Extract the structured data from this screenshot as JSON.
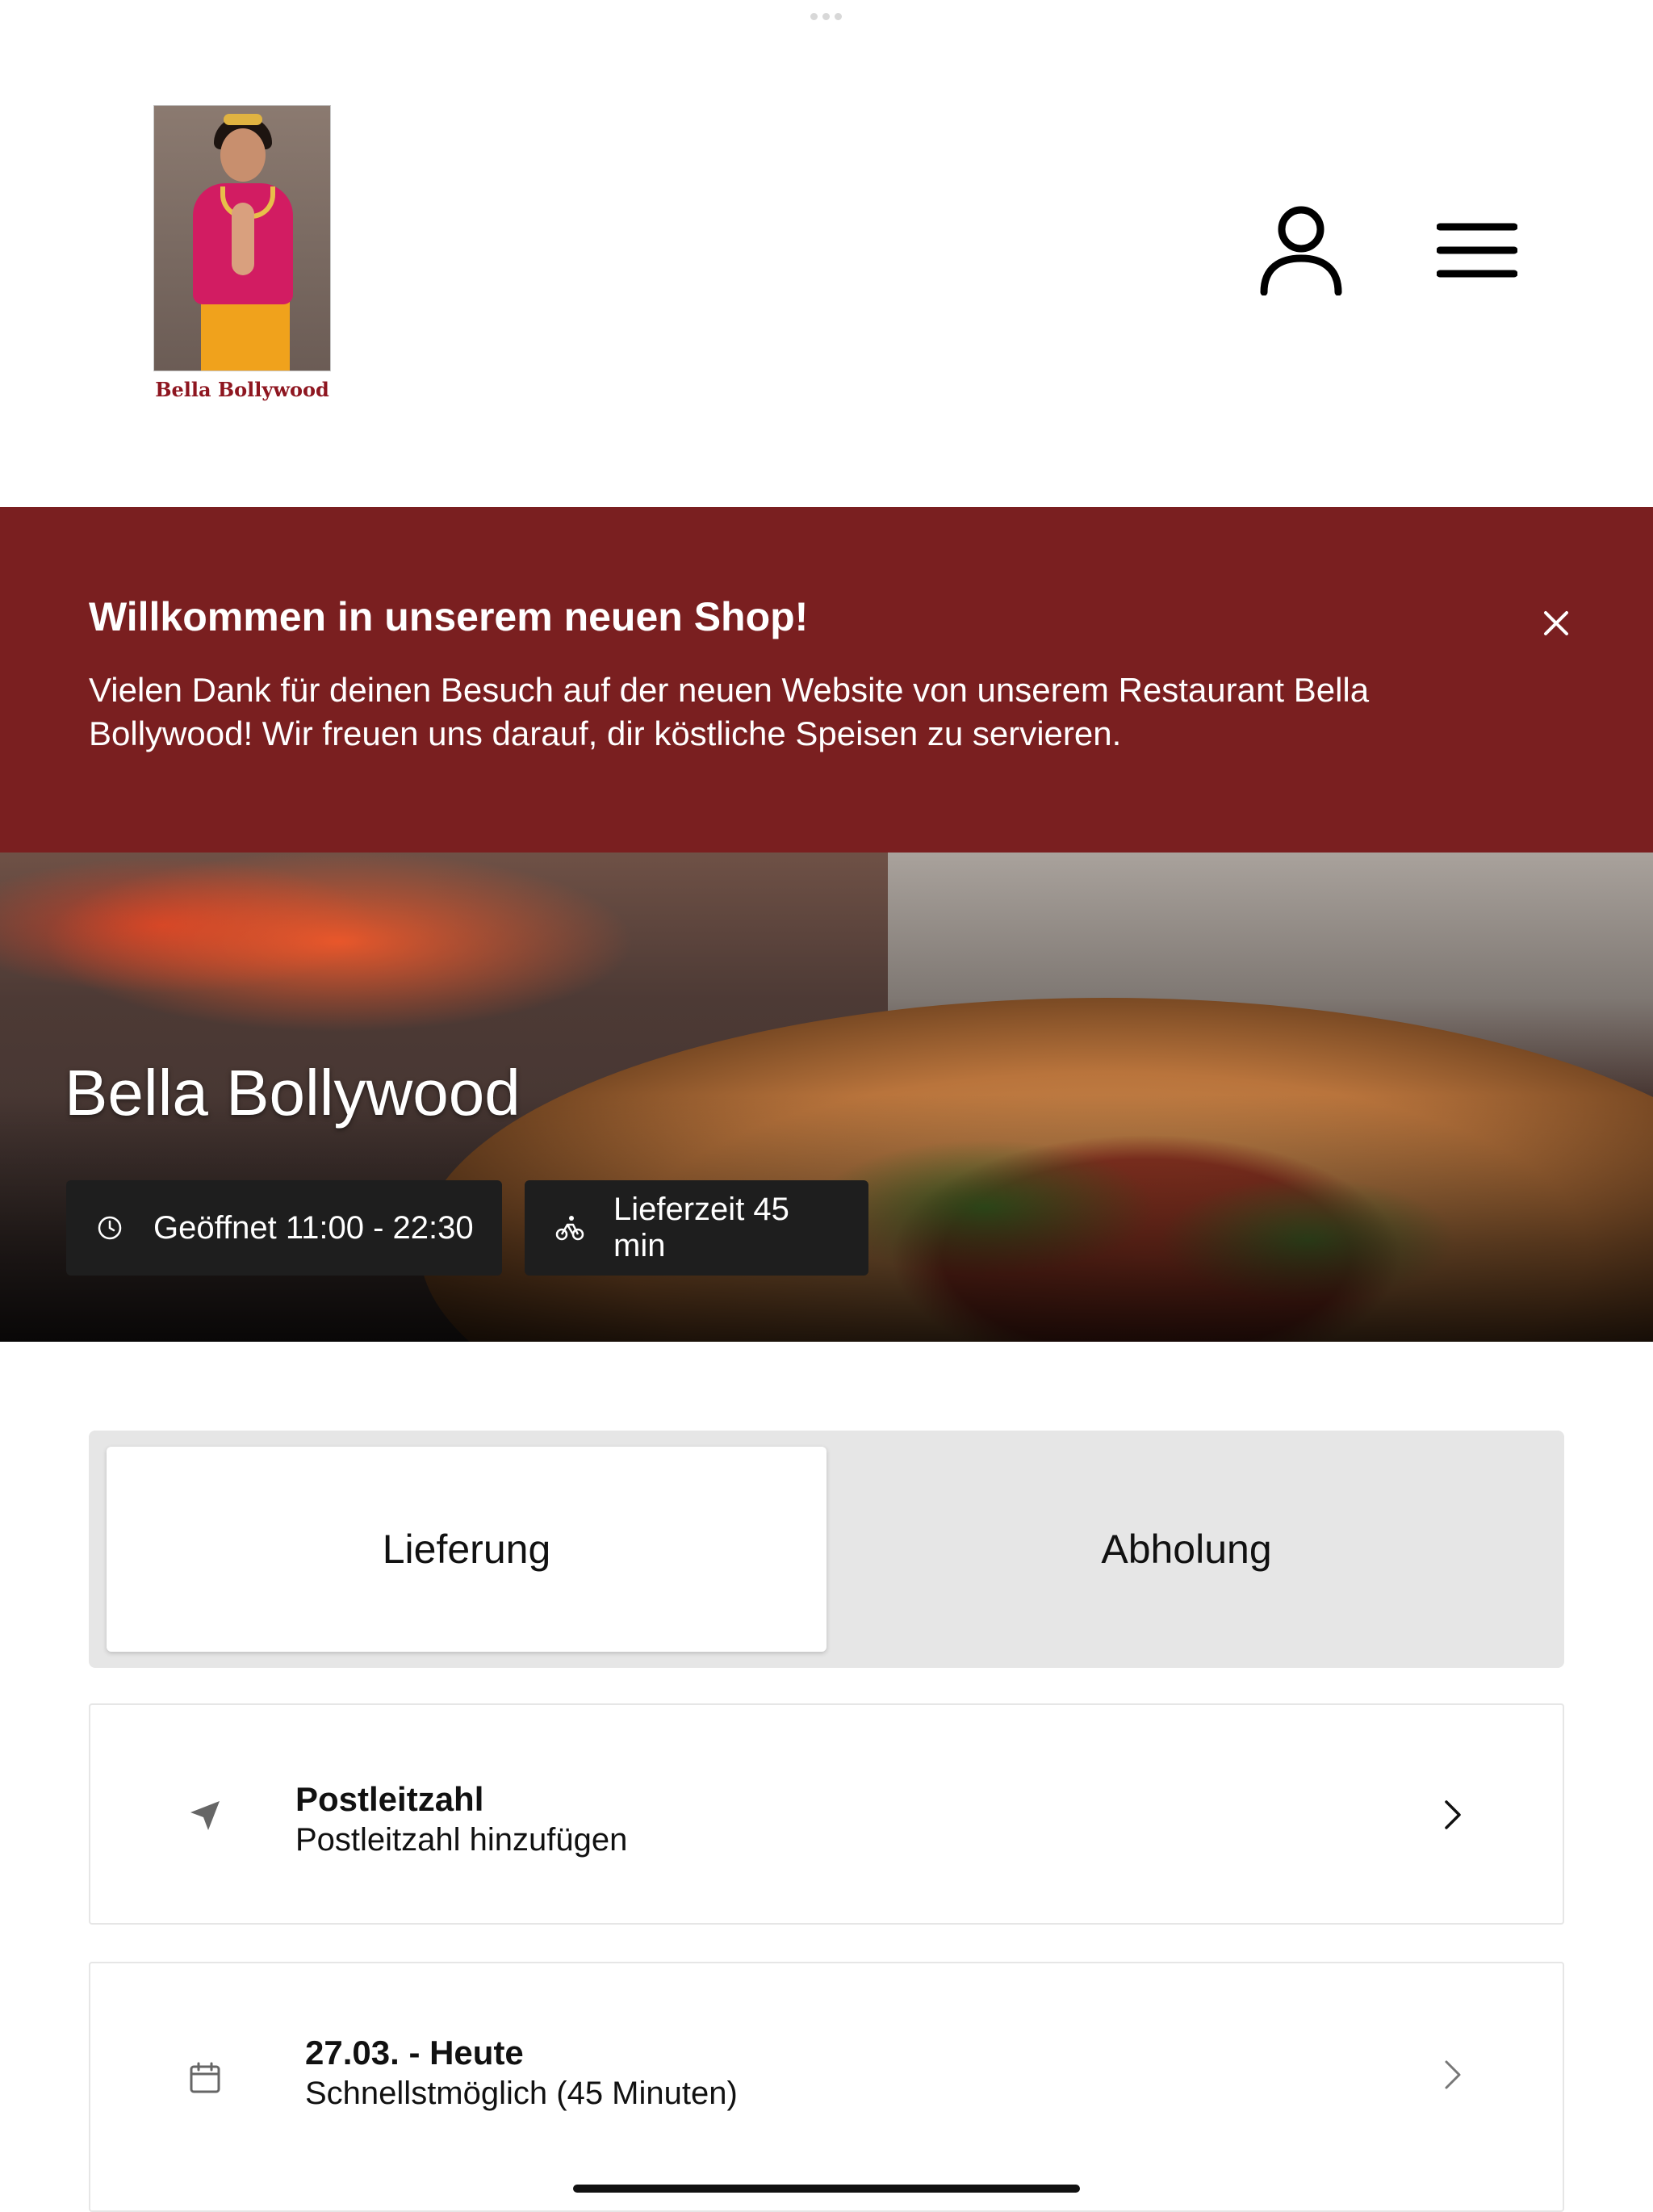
{
  "header": {
    "logo_text": "Bella Bollywood",
    "account_icon": "user-icon",
    "menu_icon": "hamburger-menu-icon"
  },
  "banner": {
    "title": "Willkommen in unserem neuen Shop!",
    "text": "Vielen Dank für deinen Besuch auf der neuen Website von unserem Restaurant Bella Bollywood! Wir freuen uns darauf, dir köstliche Speisen zu servieren.",
    "close_icon": "close-icon",
    "background_color": "#7a1f20"
  },
  "hero": {
    "title": "Bella Bollywood",
    "opening_hours": "Geöffnet 11:00 - 22:30",
    "delivery_time": "Lieferzeit 45 min"
  },
  "order_mode": {
    "tabs": [
      {
        "label": "Lieferung",
        "active": true
      },
      {
        "label": "Abholung",
        "active": false
      }
    ]
  },
  "postcode": {
    "title": "Postleitzahl",
    "subtitle": "Postleitzahl hinzufügen",
    "icon": "location-arrow-icon"
  },
  "schedule": {
    "title": "27.03. - Heute",
    "subtitle": "Schnellstmöglich (45 Minuten)",
    "icon": "calendar-icon"
  }
}
